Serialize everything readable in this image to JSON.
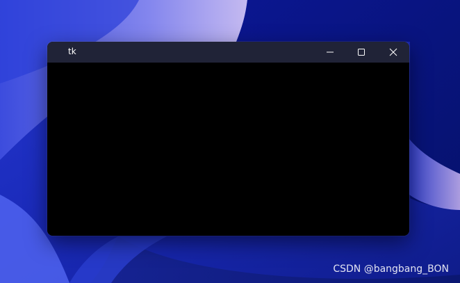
{
  "window": {
    "title": "tk"
  },
  "controls": {
    "minimize_icon": "minimize-icon",
    "maximize_icon": "maximize-icon",
    "close_icon": "close-icon"
  },
  "watermark": {
    "text": "CSDN @bangbang_BON"
  },
  "colors": {
    "titlebar": "#202337",
    "client": "#000000",
    "wallpaper_base": "#1730c4"
  }
}
